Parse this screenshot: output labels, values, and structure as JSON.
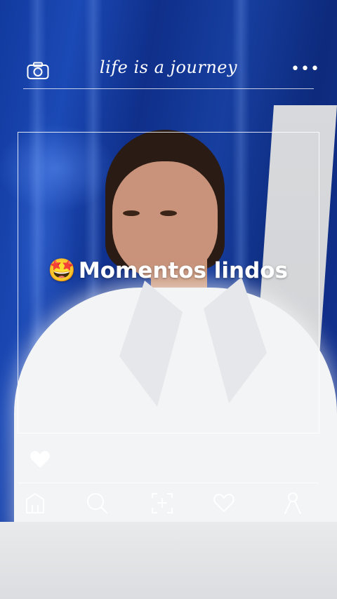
{
  "header": {
    "title": "life is a journey",
    "camera_icon": "camera-icon",
    "more_label": "•••"
  },
  "caption": {
    "emoji": "🤩",
    "text": "Momentos lindos"
  },
  "actions": {
    "like_icon": "heart-icon"
  },
  "bottom_nav": {
    "items": [
      "home-icon",
      "search-icon",
      "add-post-icon",
      "favorites-icon",
      "profile-icon"
    ]
  },
  "colors": {
    "background_blue": "#123a9e",
    "frame_white": "#ffffff"
  }
}
